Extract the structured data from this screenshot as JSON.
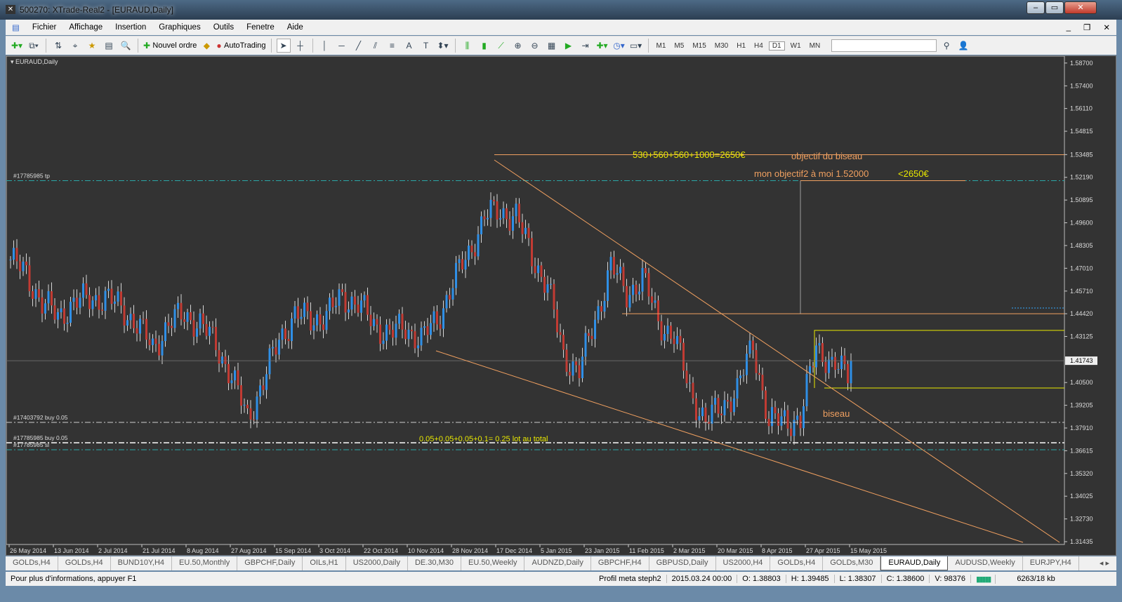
{
  "window": {
    "title": "500270: XTrade-Real2 - [EURAUD,Daily]",
    "app_icon": "mt4-icon"
  },
  "menu": [
    "Fichier",
    "Affichage",
    "Insertion",
    "Graphiques",
    "Outils",
    "Fenetre",
    "Aide"
  ],
  "toolbar": {
    "new_order": "Nouvel ordre",
    "autotrading": "AutoTrading",
    "timeframes": [
      "M1",
      "M5",
      "M15",
      "M30",
      "H1",
      "H4",
      "D1",
      "W1",
      "MN"
    ],
    "active_timeframe": "D1",
    "search_value": ""
  },
  "chart_data": {
    "type": "candlestick",
    "title": "EURAUD,Daily",
    "price_ticks": [
      "1.58700",
      "1.57400",
      "1.56110",
      "1.54815",
      "1.53485",
      "1.52190",
      "1.50895",
      "1.49600",
      "1.48305",
      "1.47010",
      "1.45710",
      "1.44420",
      "1.43125",
      "1.40500",
      "1.39205",
      "1.37910",
      "1.36615",
      "1.35320",
      "1.34025",
      "1.32730",
      "1.31435"
    ],
    "ylim": [
      1.31435,
      1.587
    ],
    "current_price": "1.41743",
    "date_ticks": [
      "26 May 2014",
      "13 Jun 2014",
      "2 Jul 2014",
      "21 Jul 2014",
      "8 Aug 2014",
      "27 Aug 2014",
      "15 Sep 2014",
      "3 Oct 2014",
      "22 Oct 2014",
      "10 Nov 2014",
      "28 Nov 2014",
      "17 Dec 2014",
      "5 Jan 2015",
      "23 Jan 2015",
      "11 Feb 2015",
      "2 Mar 2015",
      "20 Mar 2015",
      "8 Apr 2015",
      "27 Apr 2015",
      "15 May 2015"
    ],
    "weekly_closes_approx": [
      1.475,
      1.467,
      1.45,
      1.443,
      1.45,
      1.453,
      1.453,
      1.448,
      1.438,
      1.425,
      1.438,
      1.444,
      1.438,
      1.427,
      1.408,
      1.385,
      1.405,
      1.43,
      1.443,
      1.441,
      1.443,
      1.454,
      1.45,
      1.438,
      1.433,
      1.436,
      1.43,
      1.44,
      1.462,
      1.478,
      1.5,
      1.502,
      1.5,
      1.477,
      1.46,
      1.42,
      1.412,
      1.44,
      1.472,
      1.455,
      1.465,
      1.44,
      1.431,
      1.401,
      1.382,
      1.392,
      1.4,
      1.428,
      1.381,
      1.385,
      1.382,
      1.428,
      1.413,
      1.412
    ],
    "colors": {
      "bull": "#2f8fe6",
      "bear": "#c23b33",
      "wick": "#ffffff",
      "trend": "#f0a060",
      "yellow": "#e8e800",
      "level": "#2aa7a7"
    },
    "order_levels": [
      {
        "label": "#17785985 tp",
        "price": 1.52,
        "color": "#2aa7a7"
      },
      {
        "label": "#17403792 buy 0.05",
        "price": 1.3823,
        "color": "#cccccc"
      },
      {
        "label": "#17785985 buy 0.05",
        "price": 1.3707,
        "color": "#eeeeee"
      },
      {
        "label": "#17785985 sl",
        "price": 1.3667,
        "color": "#2aa7a7"
      }
    ],
    "horizontal_lines": [
      {
        "price": 1.5348,
        "color": "#f0a060"
      },
      {
        "price": 1.4442,
        "color": "#f0a060"
      }
    ],
    "box": {
      "top": 1.4347,
      "bottom": 1.4019,
      "color": "#e8e800"
    },
    "annotations": [
      {
        "text": "530+560+560+1000=2650€",
        "color": "#e8e800"
      },
      {
        "text": "objectif du biseau",
        "color": "#f0a060"
      },
      {
        "text": "mon objectif2 à moi 1.52000 ",
        "color": "#f0a060"
      },
      {
        "text": "<2650€",
        "color": "#e8e800"
      },
      {
        "text": "biseau",
        "color": "#f0a060"
      },
      {
        "text": "0.05+0.05+0.05+0.1= 0.25 lot au total",
        "color": "#e8e800"
      }
    ]
  },
  "tabs": [
    "GOLDs,H4",
    "GOLDs,H4",
    "BUND10Y,H4",
    "EU.50,Monthly",
    "GBPCHF,Daily",
    "OILs,H1",
    "US2000,Daily",
    "DE.30,M30",
    "EU.50,Weekly",
    "AUDNZD,Daily",
    "GBPCHF,H4",
    "GBPUSD,Daily",
    "US2000,H4",
    "GOLDs,H4",
    "GOLDs,M30",
    "EURAUD,Daily",
    "AUDUSD,Weekly",
    "EURJPY,H4"
  ],
  "active_tab": "EURAUD,Daily",
  "status": {
    "hint": "Pour plus d'informations, appuyer F1",
    "profile": "Profil meta steph2",
    "datetime": "2015.03.24 00:00",
    "open": "O: 1.38803",
    "high": "H: 1.39485",
    "low": "L: 1.38307",
    "close": "C: 1.38600",
    "volume": "V: 98376",
    "traffic": "6263/18 kb"
  }
}
